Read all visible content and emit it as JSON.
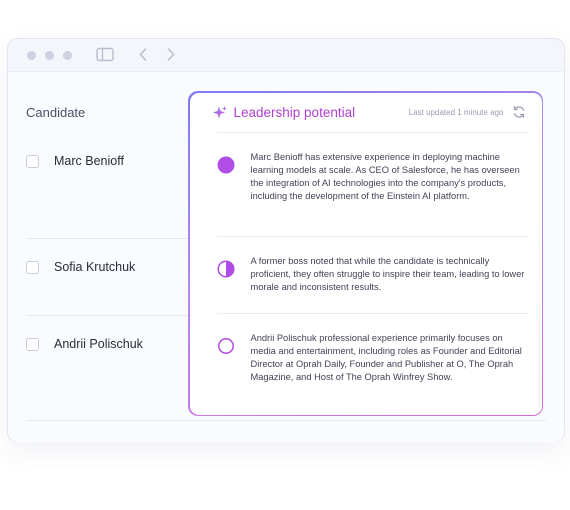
{
  "toolbar": {
    "window_dots": [
      "close",
      "minimize",
      "maximize"
    ],
    "icons": [
      "sidebar-toggle-icon",
      "back-icon",
      "forward-icon"
    ]
  },
  "table": {
    "column_header": "Candidate"
  },
  "panel": {
    "title": "Leadership potential",
    "last_updated": "Last updated 1 minute ago",
    "icons": [
      "sparkle-icon",
      "refresh-icon"
    ]
  },
  "candidates": [
    {
      "name": "Marc Benioff",
      "rating": "full",
      "description": "Marc Benioff has extensive experience in deploying machine learning models at scale. As CEO of Salesforce, he has overseen the integration of AI technologies into the company's products, including the development of the Einstein AI platform."
    },
    {
      "name": "Sofia Krutchuk",
      "rating": "half",
      "description": "A former boss noted that while the candidate is technically proficient, they often struggle to inspire their team, leading to lower morale and inconsistent results."
    },
    {
      "name": "Andrii Polischuk",
      "rating": "empty",
      "description": "Andrii Polischuk professional experience primarily focuses on media and entertainment, including roles as Founder and Editorial Director at Oprah Daily, Founder and Publisher at O, The Oprah Magazine, and Host of The Oprah Winfrey Show."
    }
  ],
  "colors": {
    "accent": "#b13fd1",
    "rating_fill": "#b04de6",
    "border_start": "#7d7bf0",
    "border_end": "#d66ad8"
  }
}
